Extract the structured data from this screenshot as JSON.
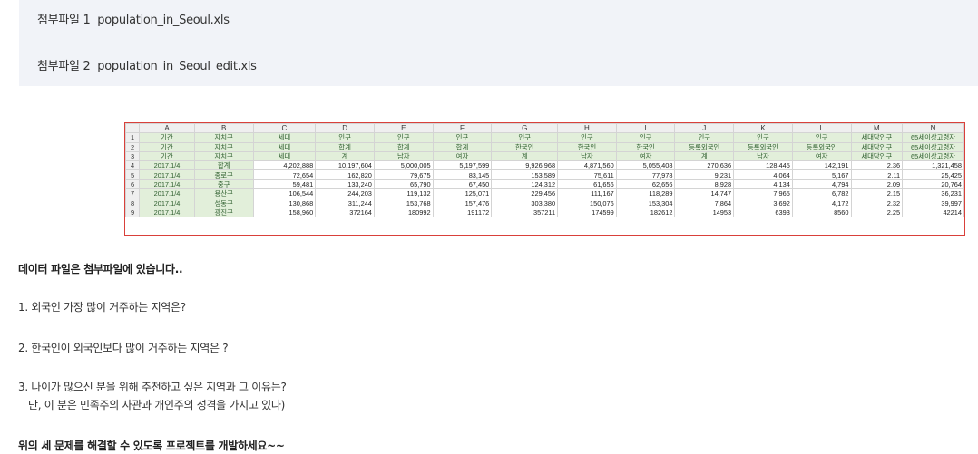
{
  "attachments": [
    {
      "prefix": "첨부파일 1",
      "filename": "population_in_Seoul.xls"
    },
    {
      "prefix": "첨부파일 2",
      "filename": "population_in_Seoul_edit.xls"
    }
  ],
  "spreadsheet": {
    "columns": [
      "A",
      "B",
      "C",
      "D",
      "E",
      "F",
      "G",
      "H",
      "I",
      "J",
      "K",
      "L",
      "M",
      "N"
    ],
    "rows": [
      {
        "num": "1",
        "cells": [
          "기간",
          "자치구",
          "세대",
          "인구",
          "인구",
          "인구",
          "인구",
          "인구",
          "인구",
          "인구",
          "인구",
          "인구",
          "세대당인구",
          "65세이상고령자"
        ]
      },
      {
        "num": "2",
        "cells": [
          "기간",
          "자치구",
          "세대",
          "합계",
          "합계",
          "합계",
          "한국인",
          "한국인",
          "한국인",
          "등록외국인",
          "등록외국인",
          "등록외국인",
          "세대당인구",
          "65세이상고령자"
        ]
      },
      {
        "num": "3",
        "cells": [
          "기간",
          "자치구",
          "세대",
          "계",
          "남자",
          "여자",
          "계",
          "남자",
          "여자",
          "계",
          "남자",
          "여자",
          "세대당인구",
          "65세이상고령자"
        ]
      },
      {
        "num": "4",
        "cells": [
          "2017.1/4",
          "합계",
          "4,202,888",
          "10,197,604",
          "5,000,005",
          "5,197,599",
          "9,926,968",
          "4,871,560",
          "5,055,408",
          "270,636",
          "128,445",
          "142,191",
          "2.36",
          "1,321,458"
        ]
      },
      {
        "num": "5",
        "cells": [
          "2017.1/4",
          "종로구",
          "72,654",
          "162,820",
          "79,675",
          "83,145",
          "153,589",
          "75,611",
          "77,978",
          "9,231",
          "4,064",
          "5,167",
          "2.11",
          "25,425"
        ]
      },
      {
        "num": "6",
        "cells": [
          "2017.1/4",
          "중구",
          "59,481",
          "133,240",
          "65,790",
          "67,450",
          "124,312",
          "61,656",
          "62,656",
          "8,928",
          "4,134",
          "4,794",
          "2.09",
          "20,764"
        ]
      },
      {
        "num": "7",
        "cells": [
          "2017.1/4",
          "용산구",
          "106,544",
          "244,203",
          "119,132",
          "125,071",
          "229,456",
          "111,167",
          "118,289",
          "14,747",
          "7,965",
          "6,782",
          "2.15",
          "36,231"
        ]
      },
      {
        "num": "8",
        "cells": [
          "2017.1/4",
          "성동구",
          "130,868",
          "311,244",
          "153,768",
          "157,476",
          "303,380",
          "150,076",
          "153,304",
          "7,864",
          "3,692",
          "4,172",
          "2.32",
          "39,997"
        ]
      },
      {
        "num": "9",
        "cells": [
          "2017.1/4",
          "광진구",
          "158,960",
          "372164",
          "180992",
          "191172",
          "357211",
          "174599",
          "182612",
          "14953",
          "6393",
          "8560",
          "2.25",
          "42214"
        ]
      }
    ]
  },
  "content": {
    "intro": "데이터 파일은 첨부파일에 있습니다..",
    "q1": "1. 외국인 가장 많이 거주하는 지역은?",
    "q2": "2. 한국인이 외국인보다 많이 거주하는 지역은 ?",
    "q3": "3. 나이가 많으신 분을 위해 추천하고 싶은 지역과 그 이유는?",
    "q3_note": "단, 이 분은 민족주의 사관과 개인주의 성격을 가지고 있다)",
    "closing": "위의 세 문제를 해결할 수 있도록 프로젝트를 개발하세요~~"
  }
}
